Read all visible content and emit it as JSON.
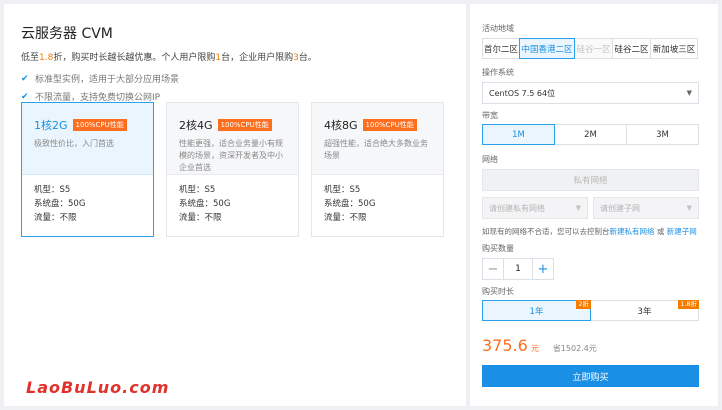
{
  "left": {
    "title": "云服务器 CVM",
    "promo": {
      "p1": "低至",
      "discount": "1.8",
      "p2": "折，购买时长越长越优惠。个人用户限购",
      "personal_limit": "1",
      "p3": "台，企业用户限购",
      "enterprise_limit": "3",
      "p4": "台。"
    },
    "features": [
      "标准型实例，适用于大部分应用场景",
      "不限流量，支持免费切换公网IP"
    ],
    "cards": [
      {
        "name": "1核2G",
        "badge": "100%CPU性能",
        "desc": "极致性价比，入门首选",
        "model": "机型：S5",
        "disk": "系统盘：50G",
        "traffic": "流量：不限",
        "selected": true
      },
      {
        "name": "2核4G",
        "badge": "100%CPU性能",
        "desc": "性能更强，适合业务量小有规模的场景，资深开发者及中小企业首选",
        "model": "机型：S5",
        "disk": "系统盘：50G",
        "traffic": "流量：不限",
        "selected": false
      },
      {
        "name": "4核8G",
        "badge": "100%CPU性能",
        "desc": "超强性能，适合绝大多数业务场景",
        "model": "机型：S5",
        "disk": "系统盘：50G",
        "traffic": "流量：不限",
        "selected": false
      }
    ],
    "watermark": "LaoBuLuo.com"
  },
  "right": {
    "region_label": "活动地域",
    "regions": [
      {
        "label": "首尔二区",
        "state": "normal"
      },
      {
        "label": "中国香港二区",
        "state": "selected"
      },
      {
        "label": "硅谷一区",
        "state": "disabled"
      },
      {
        "label": "硅谷二区",
        "state": "normal"
      },
      {
        "label": "新加坡三区",
        "state": "normal"
      }
    ],
    "os_label": "操作系统",
    "os_value": "CentOS 7.5 64位",
    "bandwidth_label": "带宽",
    "bandwidths": [
      {
        "label": "1M",
        "state": "selected"
      },
      {
        "label": "2M",
        "state": "normal"
      },
      {
        "label": "3M",
        "state": "normal"
      }
    ],
    "network_label": "网络",
    "private_network": "私有网络",
    "vpc_placeholder": "请创建私有网络",
    "subnet_placeholder": "请创建子网",
    "help": {
      "text": "如现有的网络不合适，您可以去控制台",
      "link1": "新建私有网络",
      "or": "或",
      "link2": "新建子网"
    },
    "quantity_label": "购买数量",
    "quantity": "1",
    "duration_label": "购买时长",
    "durations": [
      {
        "label": "1年",
        "tag": "2折",
        "state": "selected"
      },
      {
        "label": "3年",
        "tag": "1.8折",
        "state": "normal"
      }
    ],
    "price": "375.6",
    "price_unit": "元",
    "saving": "省1502.4元",
    "buy_label": "立即购买"
  }
}
